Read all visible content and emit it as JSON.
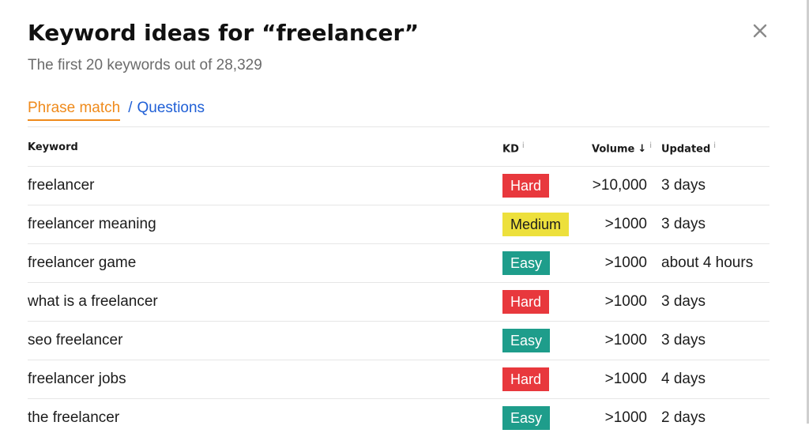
{
  "modal": {
    "title": "Keyword ideas for “freelancer”",
    "subtitle": "The first 20 keywords out of 28,329",
    "close_icon": "close-icon",
    "tabs": {
      "active": "Phrase match",
      "separator": "/",
      "other": "Questions"
    },
    "colors": {
      "tab_active": "#ef8a1b",
      "tab_link": "#1f5fd6",
      "hard": "#e8383d",
      "medium": "#ede03c",
      "easy": "#1e9d8b"
    }
  },
  "table": {
    "headers": {
      "keyword": "Keyword",
      "kd": "KD",
      "kd_info": "i",
      "volume": "Volume",
      "volume_sort": "↓",
      "volume_info": "i",
      "updated": "Updated",
      "updated_info": "i"
    },
    "rows": [
      {
        "keyword": "freelancer",
        "kd": "Hard",
        "volume": ">10,000",
        "updated": "3 days"
      },
      {
        "keyword": "freelancer meaning",
        "kd": "Medium",
        "volume": ">1000",
        "updated": "3 days"
      },
      {
        "keyword": "freelancer game",
        "kd": "Easy",
        "volume": ">1000",
        "updated": "about 4 hours"
      },
      {
        "keyword": "what is a freelancer",
        "kd": "Hard",
        "volume": ">1000",
        "updated": "3 days"
      },
      {
        "keyword": "seo freelancer",
        "kd": "Easy",
        "volume": ">1000",
        "updated": "3 days"
      },
      {
        "keyword": "freelancer jobs",
        "kd": "Hard",
        "volume": ">1000",
        "updated": "4 days"
      },
      {
        "keyword": "the freelancer",
        "kd": "Easy",
        "volume": ">1000",
        "updated": "2 days"
      }
    ]
  }
}
